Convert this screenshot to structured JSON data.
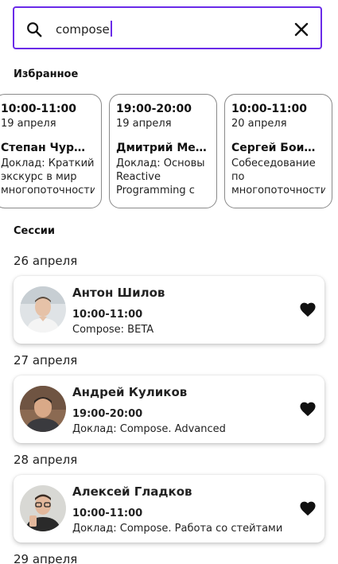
{
  "search": {
    "value": "compose"
  },
  "favorites": {
    "title": "Избранное",
    "items": [
      {
        "time": "10:00-11:00",
        "date": "19 апреля",
        "speaker": "Степан Чурюканов",
        "desc": "Доклад: Краткий экскурс в мир многопоточности"
      },
      {
        "time": "19:00-20:00",
        "date": "19 апреля",
        "speaker": "Дмитрий Мельников",
        "desc": "Доклад: Основы Reactive Programming с использованием"
      },
      {
        "time": "10:00-11:00",
        "date": "20 апреля",
        "speaker": "Сергей Боишев",
        "desc": "Собеседование по многопоточности"
      }
    ]
  },
  "sessions": {
    "title": "Сессии",
    "groups": [
      {
        "date": "26 апреля",
        "speaker": "Антон Шилов",
        "time": "10:00-11:00",
        "desc": "Compose: BETA",
        "favorite": true
      },
      {
        "date": "27 апреля",
        "speaker": "Андрей Куликов",
        "time": "19:00-20:00",
        "desc": "Доклад: Compose. Advanced",
        "favorite": true
      },
      {
        "date": "28 апреля",
        "speaker": "Алексей Гладков",
        "time": "10:00-11:00",
        "desc": "Доклад: Compose. Работа со стейтами",
        "favorite": true
      },
      {
        "date": "29 апреля"
      }
    ]
  },
  "colors": {
    "accent": "#6a2be8",
    "text": "#222222",
    "card_border": "#8a8a8a"
  }
}
